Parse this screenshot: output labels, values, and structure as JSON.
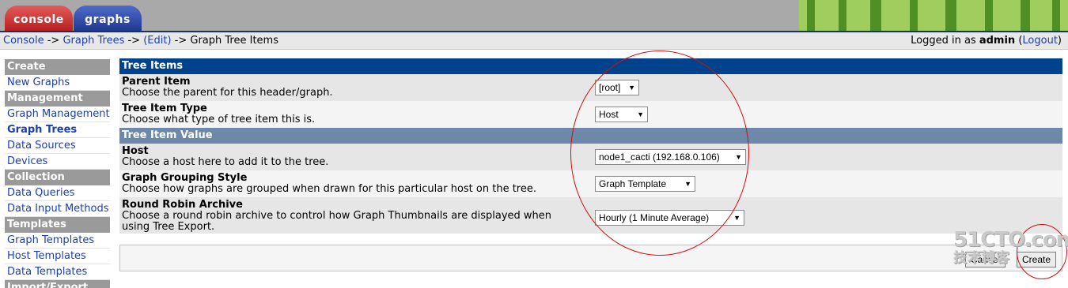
{
  "tabs": [
    {
      "label": "console"
    },
    {
      "label": "graphs"
    }
  ],
  "breadcrumb": {
    "items": [
      "Console",
      "Graph Trees",
      "(Edit)"
    ],
    "current": "Graph Tree Items",
    "separator": " -> "
  },
  "login": {
    "prefix": "Logged in as ",
    "user": "admin",
    "logout": "Logout"
  },
  "sidebar": {
    "create": {
      "header": "Create",
      "items": [
        "New Graphs"
      ]
    },
    "management": {
      "header": "Management",
      "items": [
        "Graph Management",
        "Graph Trees",
        "Data Sources",
        "Devices"
      ]
    },
    "collection": {
      "header": "Collection Methods",
      "items": [
        "Data Queries",
        "Data Input Methods"
      ]
    },
    "templates": {
      "header": "Templates",
      "items": [
        "Graph Templates",
        "Host Templates",
        "Data Templates"
      ]
    },
    "import_export": {
      "header": "Import/Export"
    }
  },
  "form": {
    "section1": "Tree Items",
    "parent": {
      "label": "Parent Item",
      "desc": "Choose the parent for this header/graph.",
      "value": "[root]"
    },
    "type": {
      "label": "Tree Item Type",
      "desc": "Choose what type of tree item this is.",
      "value": "Host"
    },
    "section2": "Tree Item Value",
    "host": {
      "label": "Host",
      "desc": "Choose a host here to add it to the tree.",
      "value": "node1_cacti (192.168.0.106)"
    },
    "grouping": {
      "label": "Graph Grouping Style",
      "desc": "Choose how graphs are grouped when drawn for this particular host on the tree.",
      "value": "Graph Template"
    },
    "rra": {
      "label": "Round Robin Archive",
      "desc": "Choose a round robin archive to control how Graph Thumbnails are displayed when using Tree Export.",
      "value": "Hourly (1 Minute Average)"
    }
  },
  "buttons": {
    "cancel": "Cancel",
    "create": "Create"
  },
  "watermark": {
    "line1": "51CTO.com",
    "line2": "技术博客"
  },
  "colors": {
    "tab_console": "#c8282a",
    "tab_graphs": "#2a4299",
    "header_dark": "#00438c",
    "header_light": "#6d88a8",
    "link": "#1a3fae",
    "annotation": "#d01010"
  }
}
